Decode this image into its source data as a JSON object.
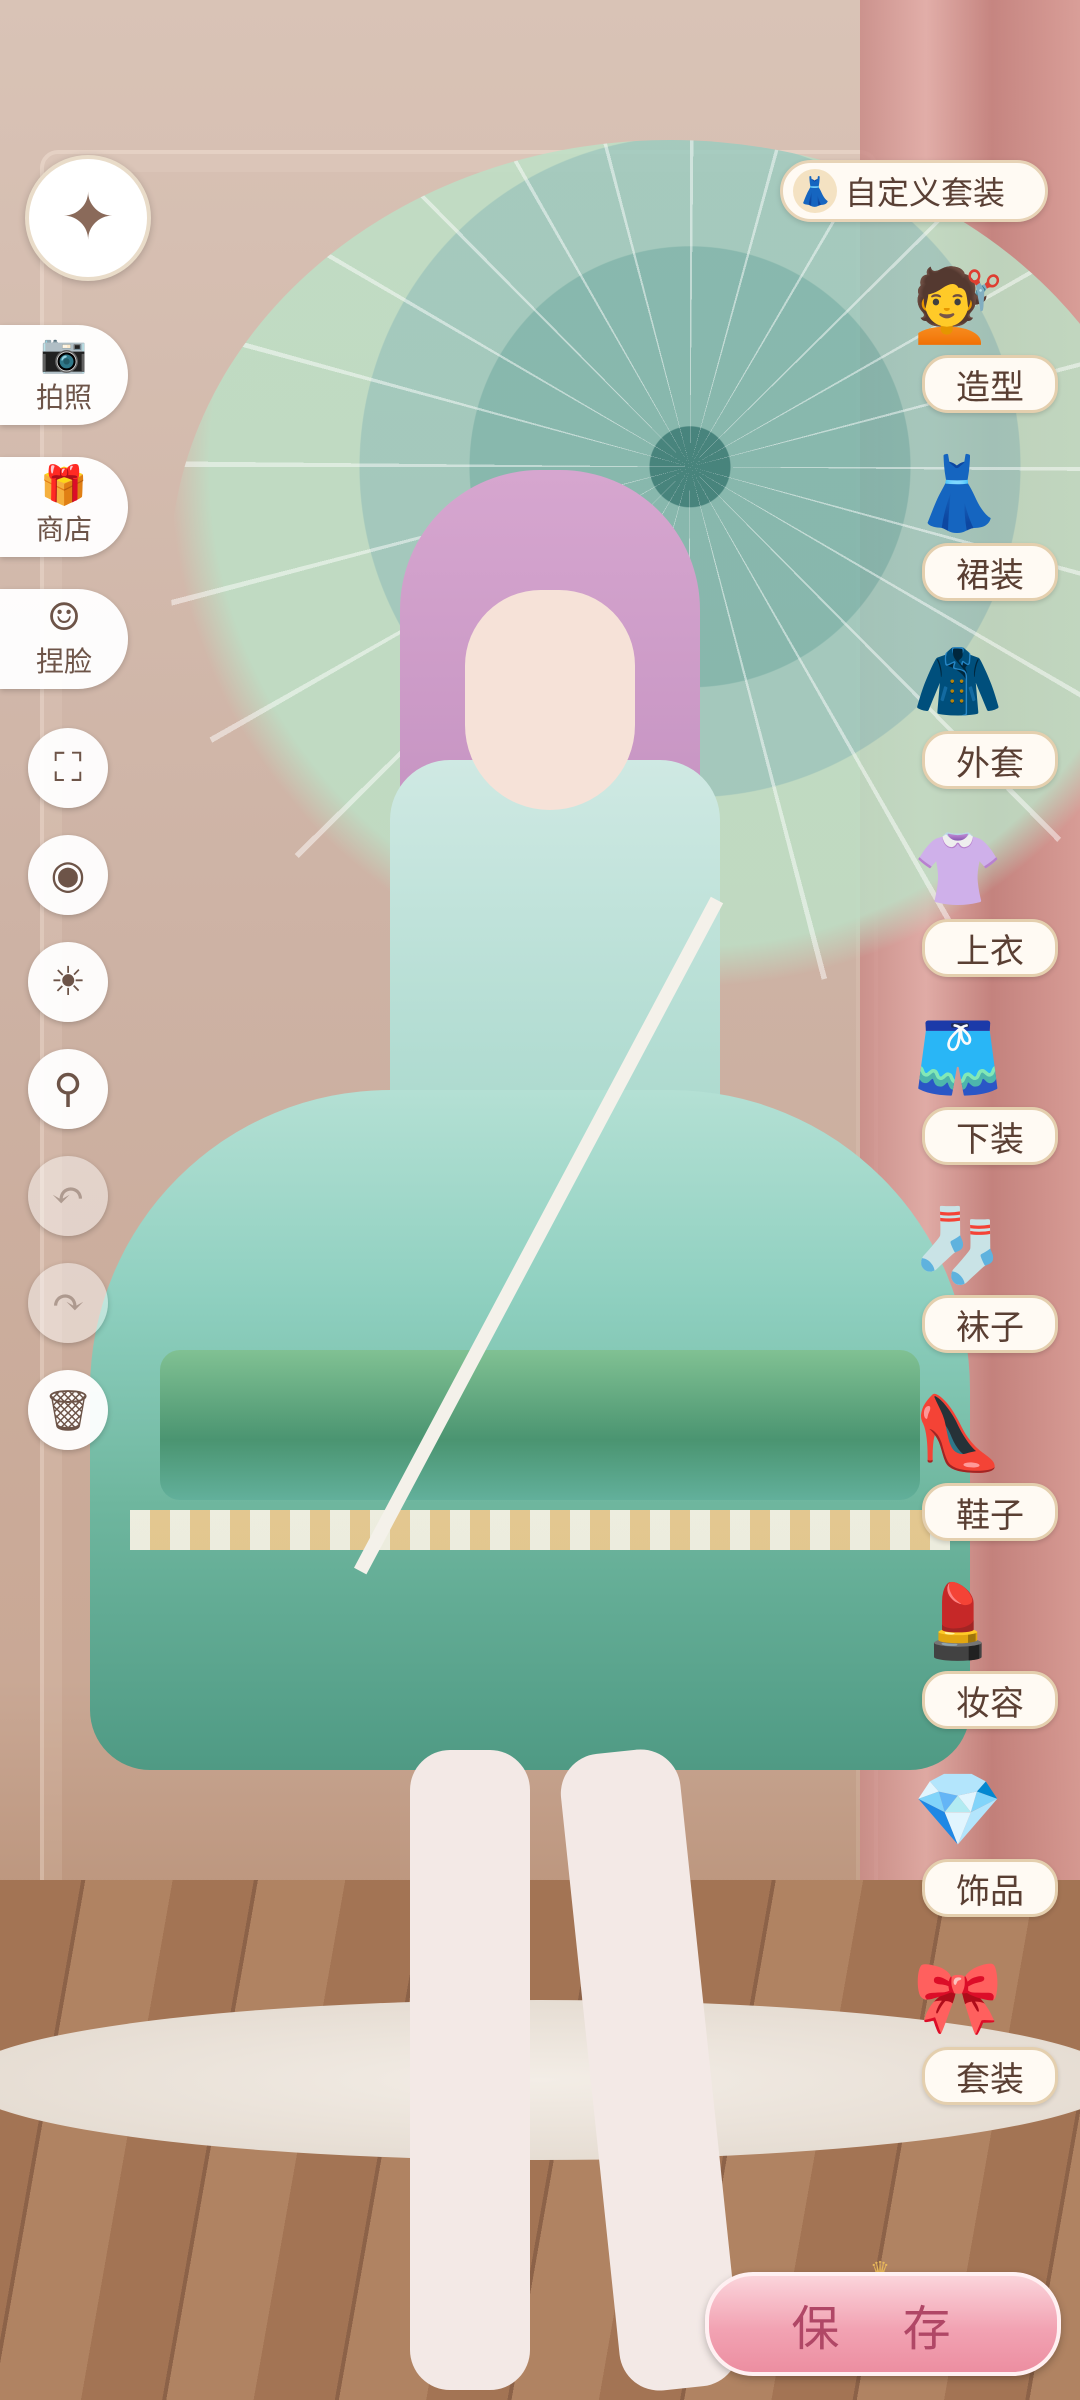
{
  "top_right": {
    "custom_outfit_label": "自定义套装",
    "custom_outfit_icon": "dress-icon"
  },
  "left_tools": [
    {
      "label": "拍照",
      "icon": "camera-icon"
    },
    {
      "label": "商店",
      "icon": "shop-icon"
    },
    {
      "label": "捏脸",
      "icon": "face-icon"
    }
  ],
  "left_round_buttons": [
    {
      "icon": "fullscreen-icon",
      "enabled": true
    },
    {
      "icon": "eye-icon",
      "enabled": true
    },
    {
      "icon": "light-icon",
      "enabled": true
    },
    {
      "icon": "zoom-icon",
      "enabled": true
    },
    {
      "icon": "undo-icon",
      "enabled": false
    },
    {
      "icon": "redo-icon",
      "enabled": false
    },
    {
      "icon": "trash-icon",
      "enabled": true
    }
  ],
  "categories": [
    {
      "label": "造型",
      "icon": "hairstyle-icon"
    },
    {
      "label": "裙装",
      "icon": "dress-icon"
    },
    {
      "label": "外套",
      "icon": "coat-icon"
    },
    {
      "label": "上衣",
      "icon": "top-icon"
    },
    {
      "label": "下装",
      "icon": "skirt-icon"
    },
    {
      "label": "袜子",
      "icon": "socks-icon"
    },
    {
      "label": "鞋子",
      "icon": "shoes-icon"
    },
    {
      "label": "妆容",
      "icon": "makeup-icon"
    },
    {
      "label": "饰品",
      "icon": "accessory-icon"
    },
    {
      "label": "套装",
      "icon": "outfit-icon"
    }
  ],
  "save_label": "保 存",
  "colors": {
    "accent_pink": "#ec8ea1",
    "panel_cream": "#fffaf3",
    "text_brown": "#5a3f33"
  }
}
